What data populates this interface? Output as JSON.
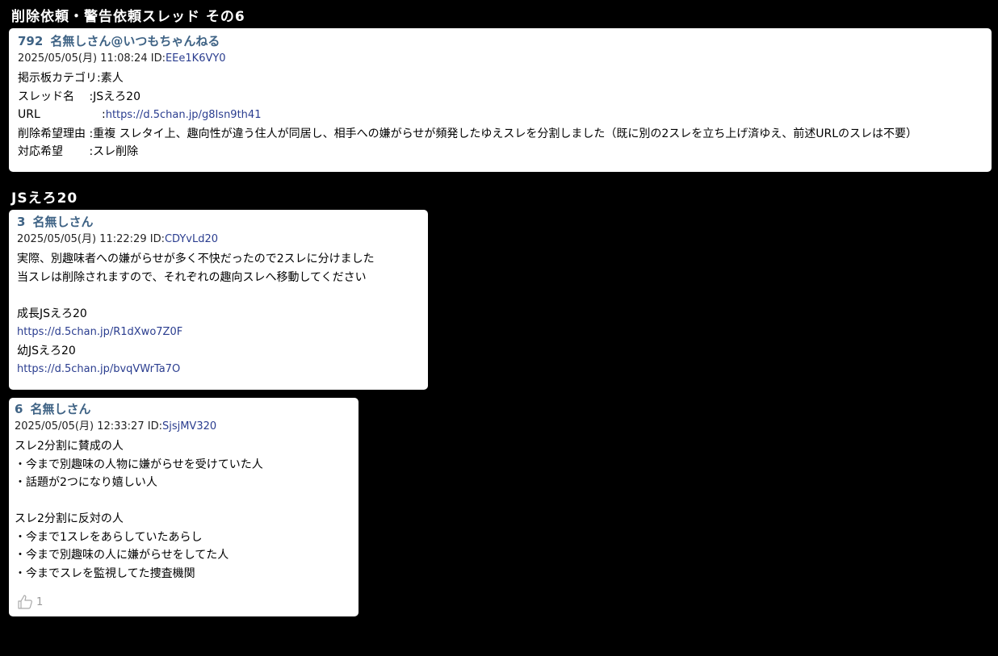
{
  "thread1": {
    "title": "削除依頼・警告依頼スレッド その6",
    "post": {
      "number": "792",
      "name": "名無しさん@いつもちゃんねる",
      "datetime": "2025/05/05(月) 11:08:24",
      "id_label": "ID:",
      "id_value": "EEe1K6VY0",
      "category_key": "掲示板カテゴリ:",
      "category_value": "素人",
      "thread_name_key": "スレッド名　 :",
      "thread_name_value": "JSえろ20",
      "url_key": "URL",
      "url_sep": ":",
      "url_value": "https://d.5chan.jp/g8Isn9th41",
      "reason_key": "削除希望理由 :",
      "reason_value": "重複 スレタイ上、趣向性が違う住人が同居し、相手への嫌がらせが頻発したゆえスレを分割しました（既に別の2スレを立ち上げ済ゆえ、前述URLのスレは不要）",
      "action_key": "対応希望 　　:",
      "action_value": "スレ削除"
    }
  },
  "thread2": {
    "title": "JSえろ20",
    "post3": {
      "number": "3",
      "name": "名無しさん",
      "datetime": "2025/05/05(月) 11:22:29",
      "id_label": "ID:",
      "id_value": "CDYvLd20",
      "lines": [
        "実際、別趣味者への嫌がらせが多く不快だったので2スレに分けました",
        "当スレは削除されますので、それぞれの趣向スレへ移動してください"
      ],
      "link1_label": "成長JSえろ20",
      "link1_url": "https://d.5chan.jp/R1dXwo7Z0F",
      "link2_label": "幼JSえろ20",
      "link2_url": "https://d.5chan.jp/bvqVWrTa7O"
    },
    "post6": {
      "number": "6",
      "name": "名無しさん",
      "datetime": "2025/05/05(月) 12:33:27",
      "id_label": "ID:",
      "id_value": "SjsjMV320",
      "lines": [
        "スレ2分割に賛成の人",
        "・今まで別趣味の人物に嫌がらせを受けていた人",
        "・話題が2つになり嬉しい人",
        "",
        "スレ2分割に反対の人",
        "・今まで1スレをあらしていたあらし",
        "・今まで別趣味の人に嫌がらせをしてた人",
        "・今までスレを監視してた捜査機関"
      ],
      "like_count": "1"
    }
  }
}
